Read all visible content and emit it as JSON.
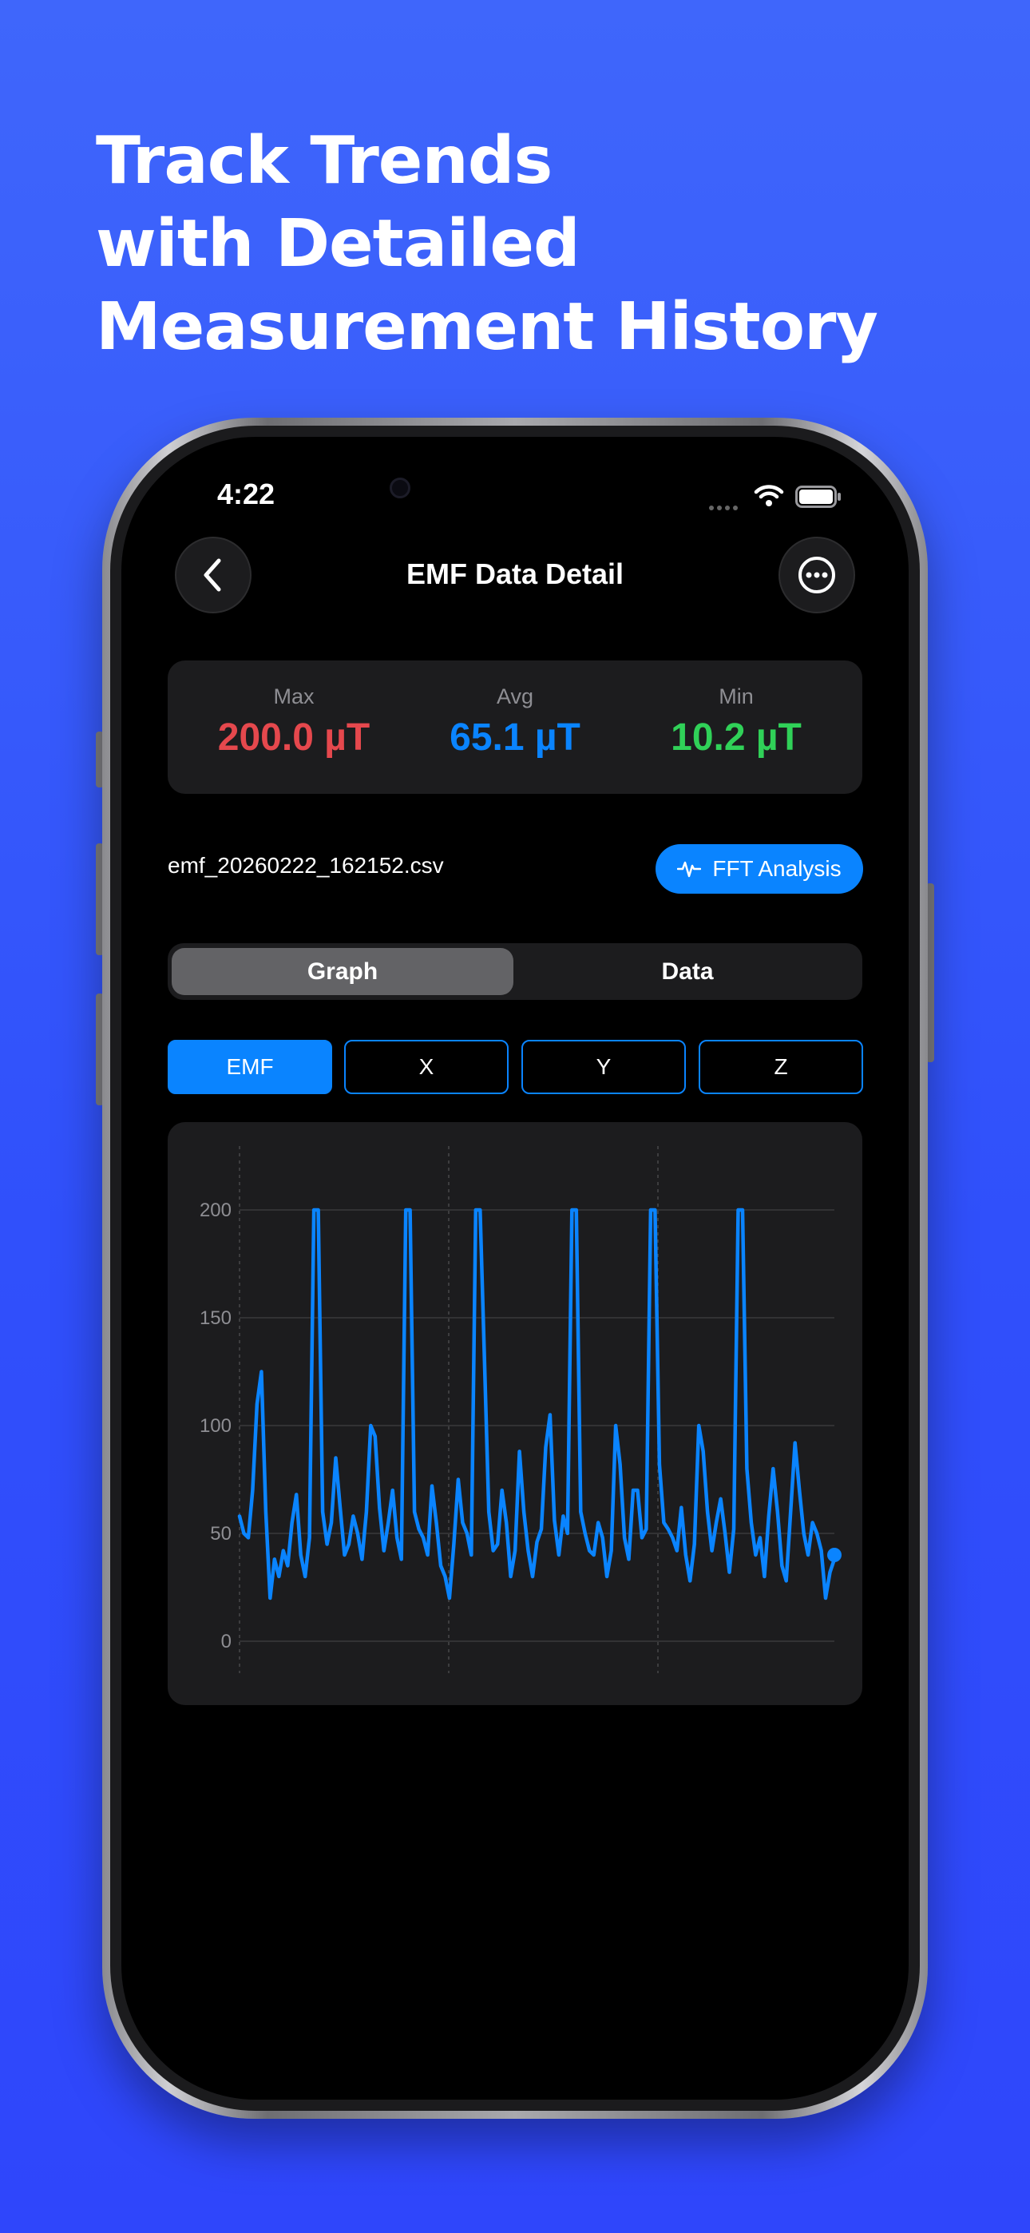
{
  "headline": [
    "Track Trends",
    "with Detailed",
    "Measurement History"
  ],
  "status_bar": {
    "time": "4:22"
  },
  "nav": {
    "title": "EMF Data Detail",
    "back_icon": "chevron-left-icon",
    "more_icon": "ellipsis-circle-icon"
  },
  "stats": [
    {
      "label": "Max",
      "value": "200.0 µT",
      "color": "#e5484d"
    },
    {
      "label": "Avg",
      "value": "65.1 µT",
      "color": "#0a84ff"
    },
    {
      "label": "Min",
      "value": "10.2 µT",
      "color": "#30d158"
    }
  ],
  "file": {
    "name": "emf_20260222_162152.csv"
  },
  "fft_button": {
    "label": "FFT Analysis",
    "icon": "waveform-icon"
  },
  "segment": {
    "options": [
      "Graph",
      "Data"
    ],
    "selected": "Graph"
  },
  "axis_buttons": {
    "options": [
      "EMF",
      "X",
      "Y",
      "Z"
    ],
    "selected": "EMF"
  },
  "colors": {
    "accent": "#0a84ff",
    "background": "#000000",
    "card": "#1c1c1e"
  },
  "chart_data": {
    "type": "line",
    "ylim": [
      0,
      200
    ],
    "yticks": [
      0,
      50,
      100,
      150,
      200
    ],
    "grid": true,
    "series": [
      {
        "color": "#0a84ff",
        "values": [
          58,
          50,
          48,
          70,
          110,
          125,
          60,
          20,
          38,
          30,
          42,
          35,
          55,
          68,
          40,
          30,
          48,
          200,
          200,
          60,
          45,
          55,
          85,
          62,
          40,
          45,
          58,
          50,
          38,
          60,
          100,
          95,
          62,
          42,
          55,
          70,
          48,
          38,
          200,
          200,
          60,
          52,
          48,
          40,
          72,
          55,
          35,
          30,
          20,
          45,
          75,
          55,
          50,
          40,
          200,
          200,
          130,
          60,
          42,
          45,
          70,
          55,
          30,
          42,
          88,
          60,
          42,
          30,
          46,
          52,
          90,
          105,
          56,
          40,
          58,
          50,
          200,
          200,
          60,
          50,
          42,
          40,
          55,
          48,
          30,
          42,
          100,
          82,
          48,
          38,
          70,
          70,
          48,
          52,
          200,
          200,
          82,
          55,
          52,
          48,
          42,
          62,
          40,
          28,
          45,
          100,
          88,
          60,
          42,
          55,
          66,
          50,
          32,
          52,
          200,
          200,
          80,
          55,
          40,
          48,
          30,
          58,
          80,
          60,
          35,
          28,
          60,
          92,
          70,
          50,
          40,
          55,
          50,
          42,
          20,
          32,
          38
        ]
      }
    ]
  }
}
